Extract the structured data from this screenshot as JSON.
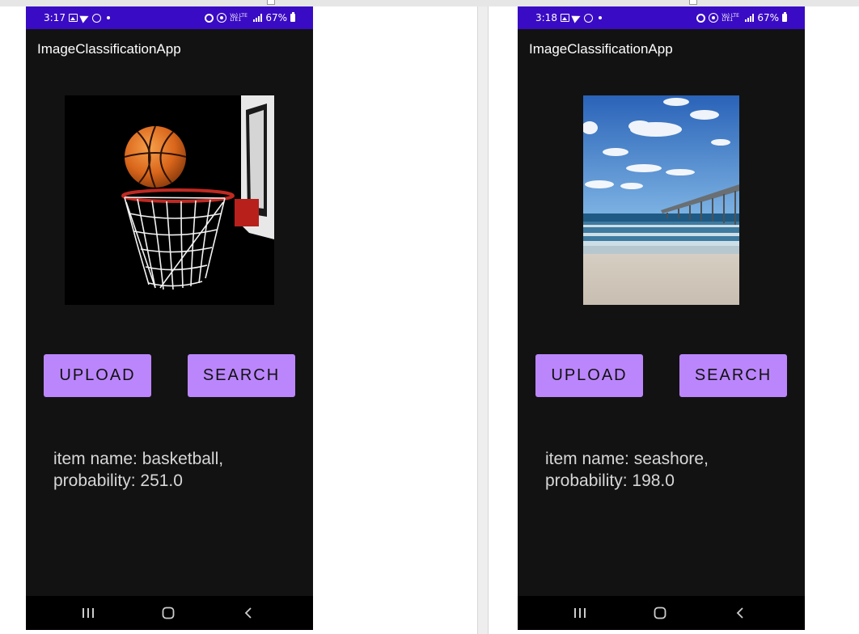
{
  "screens": [
    {
      "status": {
        "time": "3:17",
        "battery": "67%",
        "network": "Vo) LTE LTE1"
      },
      "app_title": "ImageClassificationApp",
      "image_subject": "basketball",
      "buttons": {
        "upload": "UPLOAD",
        "search": "SEARCH"
      },
      "result": {
        "line1": "item name: basketball,",
        "line2": "probability: 251.0"
      }
    },
    {
      "status": {
        "time": "3:18",
        "battery": "67%",
        "network": "Vo) LTE LTE1"
      },
      "app_title": "ImageClassificationApp",
      "image_subject": "seashore",
      "buttons": {
        "upload": "UPLOAD",
        "search": "SEARCH"
      },
      "result": {
        "line1": "item name: seashore,",
        "line2": "probability: 198.0"
      }
    }
  ],
  "colors": {
    "status_bar": "#3a0bc4",
    "app_background": "#121212",
    "button": "#bb86fc",
    "result_text": "#d7d7d7",
    "navbar": "#000000"
  },
  "icons": [
    "image-icon",
    "send-icon",
    "whatsapp-icon",
    "alarm-icon",
    "hotspot-icon",
    "signal-icon",
    "battery-icon",
    "recents-icon",
    "home-icon",
    "back-icon"
  ]
}
